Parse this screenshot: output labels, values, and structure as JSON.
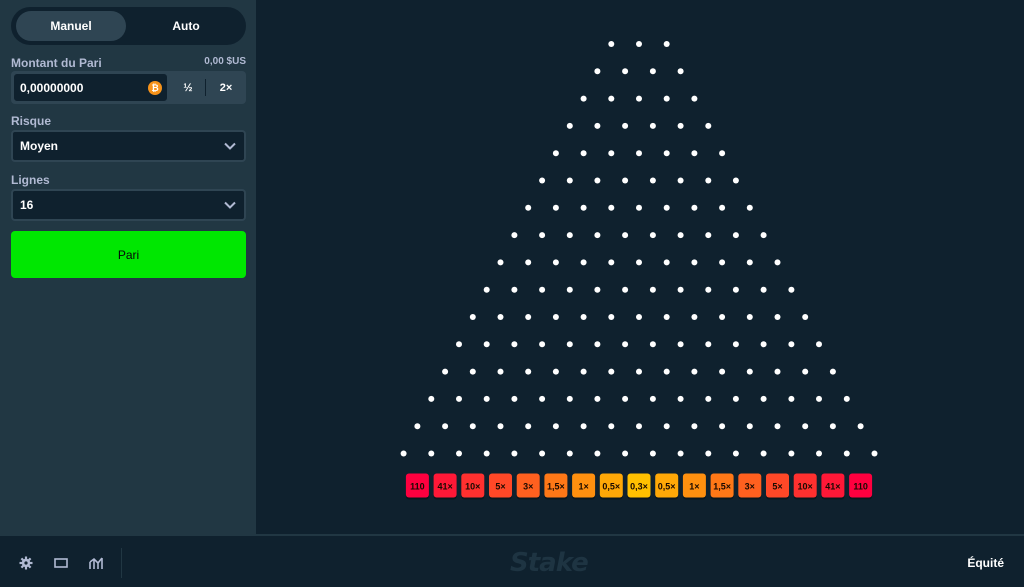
{
  "mode_toggle": {
    "manual_label": "Manuel",
    "auto_label": "Auto",
    "active": "Manuel"
  },
  "bet": {
    "label": "Montant du Pari",
    "usd_value": "0,00 $US",
    "amount": "0,00000000",
    "currency_icon": "bitcoin-icon",
    "half_label": "½",
    "double_label": "2×"
  },
  "risk": {
    "label": "Risque",
    "value": "Moyen"
  },
  "rows": {
    "label": "Lignes",
    "value": "16"
  },
  "bet_button": {
    "label": "Pari"
  },
  "board": {
    "rows": 16,
    "peg_color": "#ffffff",
    "multipliers": [
      "110",
      "41×",
      "10×",
      "5×",
      "3×",
      "1,5×",
      "1×",
      "0,5×",
      "0,3×",
      "0,5×",
      "1×",
      "1,5×",
      "3×",
      "5×",
      "10×",
      "41×",
      "110"
    ],
    "bucket_colors": [
      "#ff003f",
      "#ff1837",
      "#ff302f",
      "#ff4827",
      "#ff601f",
      "#ff7817",
      "#ff900f",
      "#ffa807",
      "#ffc000",
      "#ffa807",
      "#ff900f",
      "#ff7817",
      "#ff601f",
      "#ff4827",
      "#ff302f",
      "#ff1837",
      "#ff003f"
    ]
  },
  "bottom_bar": {
    "icons": [
      "settings-icon",
      "theatre-mode-icon",
      "stats-icon"
    ],
    "logo": "Stake",
    "fairness_label": "Équité"
  },
  "colors": {
    "accent": "#00e701",
    "sidebar": "#213743",
    "background": "#0f212e"
  }
}
